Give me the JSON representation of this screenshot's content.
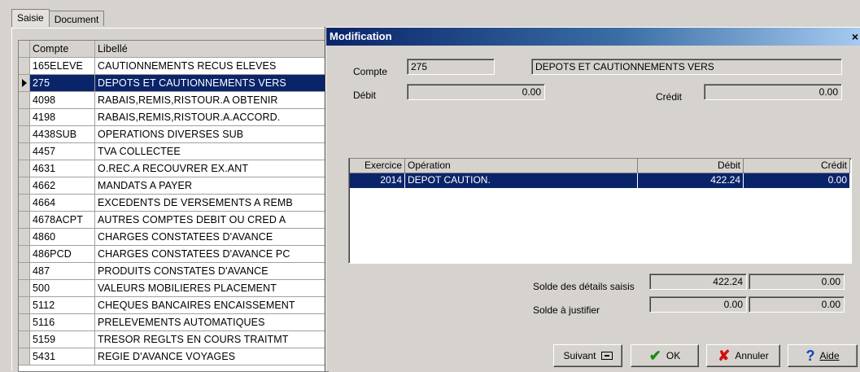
{
  "tabs": [
    {
      "label": "Saisie",
      "active": true
    },
    {
      "label": "Document",
      "active": false
    }
  ],
  "grid": {
    "headers": {
      "compte": "Compte",
      "libelle": "Libellé"
    },
    "selected_index": 1,
    "rows": [
      {
        "compte": "165ELEVE",
        "libelle": "CAUTIONNEMENTS RECUS ELEVES"
      },
      {
        "compte": "275",
        "libelle": "DEPOTS ET CAUTIONNEMENTS VERS"
      },
      {
        "compte": "4098",
        "libelle": "RABAIS,REMIS,RISTOUR.A OBTENIR"
      },
      {
        "compte": "4198",
        "libelle": "RABAIS,REMIS,RISTOUR.A.ACCORD."
      },
      {
        "compte": "4438SUB",
        "libelle": "OPERATIONS DIVERSES SUB"
      },
      {
        "compte": "4457",
        "libelle": "TVA COLLECTEE"
      },
      {
        "compte": "4631",
        "libelle": "O.REC.A RECOUVRER EX.ANT"
      },
      {
        "compte": "4662",
        "libelle": "MANDATS A PAYER"
      },
      {
        "compte": "4664",
        "libelle": "EXCEDENTS DE VERSEMENTS A REMB"
      },
      {
        "compte": "4678ACPT",
        "libelle": "AUTRES COMPTES DEBIT OU CRED A"
      },
      {
        "compte": "4860",
        "libelle": "CHARGES CONSTATEES D'AVANCE"
      },
      {
        "compte": "486PCD",
        "libelle": "CHARGES CONSTATEES D'AVANCE PC"
      },
      {
        "compte": "487",
        "libelle": "PRODUITS CONSTATES D'AVANCE"
      },
      {
        "compte": "500",
        "libelle": "VALEURS MOBILIERES PLACEMENT"
      },
      {
        "compte": "5112",
        "libelle": "CHEQUES BANCAIRES ENCAISSEMENT"
      },
      {
        "compte": "5116",
        "libelle": "PRELEVEMENTS AUTOMATIQUES"
      },
      {
        "compte": "5159",
        "libelle": "TRESOR REGLTS EN COURS TRAITMT"
      },
      {
        "compte": "5431",
        "libelle": "REGIE D'AVANCE VOYAGES"
      }
    ]
  },
  "dialog": {
    "title": "Modification",
    "close_glyph": "×",
    "compte_label": "Compte",
    "compte_value": "275",
    "compte_libelle": "DEPOTS ET CAUTIONNEMENTS VERS",
    "debit_label": "Débit",
    "debit_value": "0.00",
    "credit_label": "Crédit",
    "credit_value": "0.00",
    "table": {
      "headers": {
        "exercice": "Exercice",
        "operation": "Opération",
        "debit": "Débit",
        "credit": "Crédit"
      },
      "rows": [
        {
          "exercice": "2014",
          "operation": "DEPOT CAUTION.",
          "debit": "422.24",
          "credit": "0.00"
        }
      ]
    },
    "solde_details_label": "Solde des détails saisis",
    "solde_details_debit": "422.24",
    "solde_details_credit": "0.00",
    "solde_justifier_label": "Solde à justifier",
    "solde_justifier_debit": "0.00",
    "solde_justifier_credit": "0.00",
    "buttons": {
      "suivant": "Suivant",
      "ok": "OK",
      "annuler": "Annuler",
      "aide": "Aide"
    },
    "icons": {
      "suivant": "keyboard-icon",
      "ok": "checkmark-icon",
      "annuler": "cross-icon",
      "aide": "help-icon"
    },
    "colors": {
      "selection": "#0a246a",
      "ok_green": "#1a8a1a",
      "cancel_red": "#d01010",
      "help_blue": "#1040c0"
    }
  }
}
